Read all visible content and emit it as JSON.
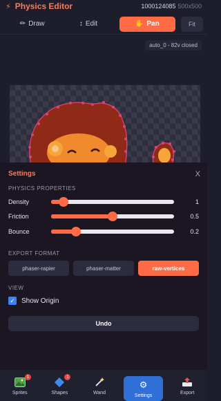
{
  "header": {
    "title": "Physics Editor",
    "file_id": "1000124085",
    "dimensions": "500x500"
  },
  "toolbar": {
    "tools": [
      {
        "label": "Draw",
        "icon": "pencil-icon"
      },
      {
        "label": "Edit",
        "icon": "move-vertical-icon"
      },
      {
        "label": "Pan",
        "icon": "hand-icon"
      }
    ],
    "active_tool": "Pan",
    "fit_label": "Fit"
  },
  "status": "auto_0 - 82v closed",
  "settings": {
    "title": "Settings",
    "close_label": "X",
    "physics_label": "PHYSICS PROPERTIES",
    "density": {
      "label": "Density",
      "value": "1",
      "fraction": 0.1
    },
    "friction": {
      "label": "Friction",
      "value": "0.5",
      "fraction": 0.5
    },
    "bounce": {
      "label": "Bounce",
      "value": "0.2",
      "fraction": 0.2
    },
    "export_label": "EXPORT FORMAT",
    "formats": [
      "phaser-rapier",
      "phaser-matter",
      "raw-vertices"
    ],
    "active_format": "raw-vertices",
    "view_label": "VIEW",
    "show_origin_label": "Show Origin",
    "show_origin_checked": true,
    "undo_label": "Undo"
  },
  "nav": {
    "items": [
      {
        "label": "Sprites",
        "icon": "image-icon",
        "badge": "1"
      },
      {
        "label": "Shapes",
        "icon": "diamond-icon",
        "badge": "1"
      },
      {
        "label": "Wand",
        "icon": "magic-wand-icon",
        "badge": ""
      },
      {
        "label": "Settings",
        "icon": "gear-icon",
        "badge": ""
      },
      {
        "label": "Export",
        "icon": "export-icon",
        "badge": ""
      }
    ],
    "active": "Settings"
  },
  "colors": {
    "accent": "#ff6b45",
    "background": "#1d1d2c",
    "active_nav": "#2f6fd6",
    "checkbox": "#3b82f6"
  }
}
